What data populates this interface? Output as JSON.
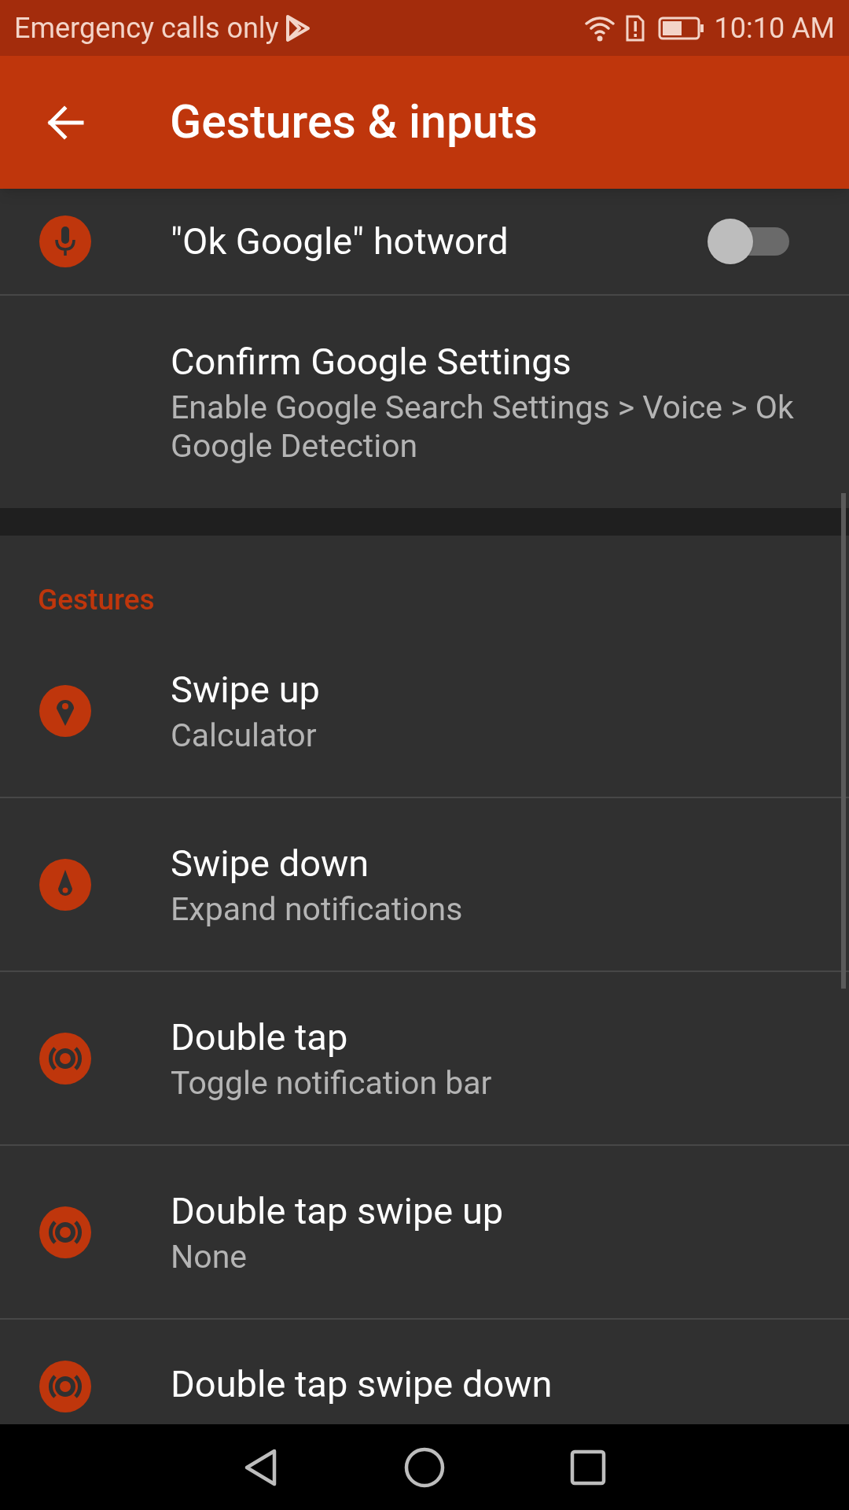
{
  "status_bar": {
    "carrier": "Emergency calls only",
    "time": "10:10 AM"
  },
  "toolbar": {
    "title": "Gestures & inputs"
  },
  "voice_settings": [
    {
      "kind": "switch",
      "title": "\"Ok Google\" hotword",
      "on": false
    },
    {
      "kind": "text",
      "title": "Confirm Google Settings",
      "summary": "Enable Google Search Settings > Voice > Ok Google Detection"
    }
  ],
  "gestures": {
    "header": "Gestures",
    "items": [
      {
        "title": "Swipe up",
        "summary": "Calculator"
      },
      {
        "title": "Swipe down",
        "summary": "Expand notifications"
      },
      {
        "title": "Double tap",
        "summary": "Toggle notification bar"
      },
      {
        "title": "Double tap swipe up",
        "summary": "None"
      },
      {
        "title": "Double tap swipe down"
      }
    ]
  }
}
